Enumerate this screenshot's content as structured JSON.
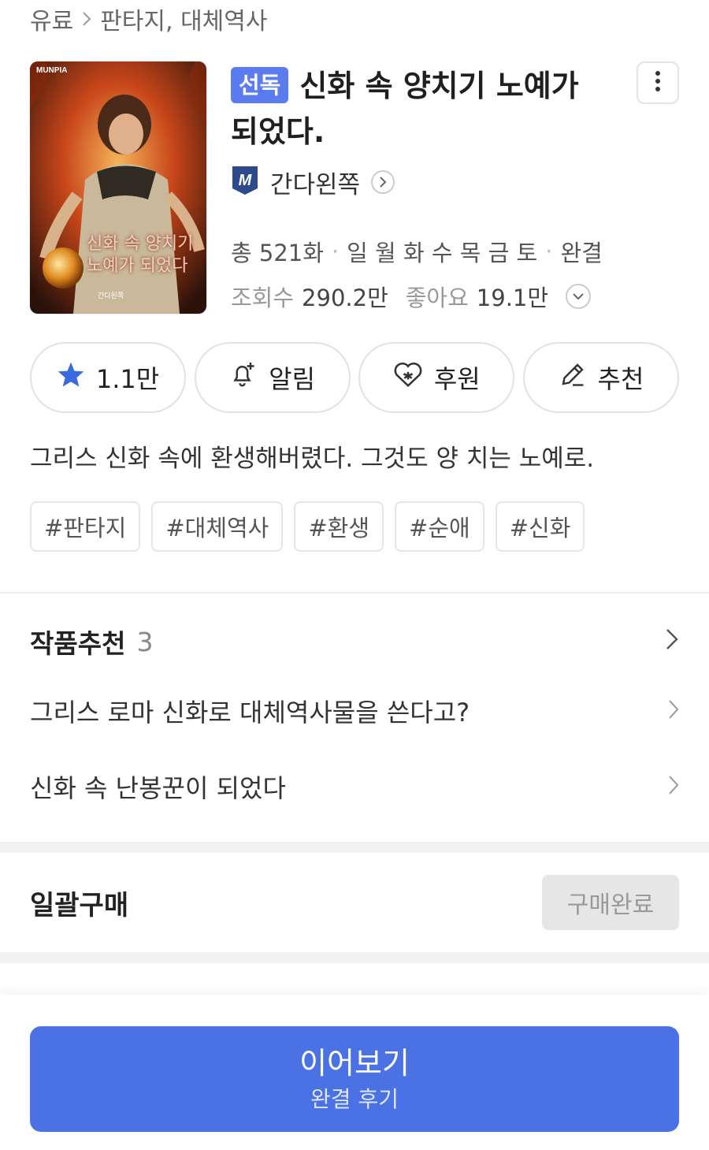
{
  "breadcrumb": {
    "root": "유료",
    "path": "판타지, 대체역사"
  },
  "cover": {
    "publisher_logo": "MUNPIA",
    "title_text": "신화 속 양치기 노예가 되었다",
    "author_text": "간다왼쪽",
    "colors": {
      "fire": "#c8461a",
      "dark": "#3a1a0e",
      "glow": "#f0a340"
    }
  },
  "work": {
    "badge": "선독",
    "title_line1": "신화 속 양치기 노예가",
    "title_line2": "되었다.",
    "author": "간다왼쪽",
    "author_icon": "munpia-logo-icon"
  },
  "meta": {
    "episodes": "총 521화",
    "days": "일 월 화 수 목 금 토",
    "status": "완결",
    "views_label": "조회수",
    "views_value": "290.2만",
    "likes_label": "좋아요",
    "likes_value": "19.1만"
  },
  "actions": {
    "favorite_count": "1.1만",
    "alert_label": "알림",
    "support_label": "후원",
    "recommend_label": "추천"
  },
  "synopsis": "그리스 신화 속에 환생해버렸다. 그것도 양 치는 노예로.",
  "tags": [
    "#판타지",
    "#대체역사",
    "#환생",
    "#순애",
    "#신화"
  ],
  "recommendations": {
    "heading": "작품추천",
    "count": "3",
    "items": [
      "그리스 로마 신화로 대체역사물을 쓴다고?",
      "신화 속 난봉꾼이 되었다"
    ]
  },
  "bulk_purchase": {
    "label": "일괄구매",
    "button": "구매완료"
  },
  "continue": {
    "main": "이어보기",
    "sub": "완결 후기"
  },
  "colors": {
    "accent": "#4a72e4",
    "badge": "#5b7bf0",
    "star": "#3b6ae0"
  }
}
